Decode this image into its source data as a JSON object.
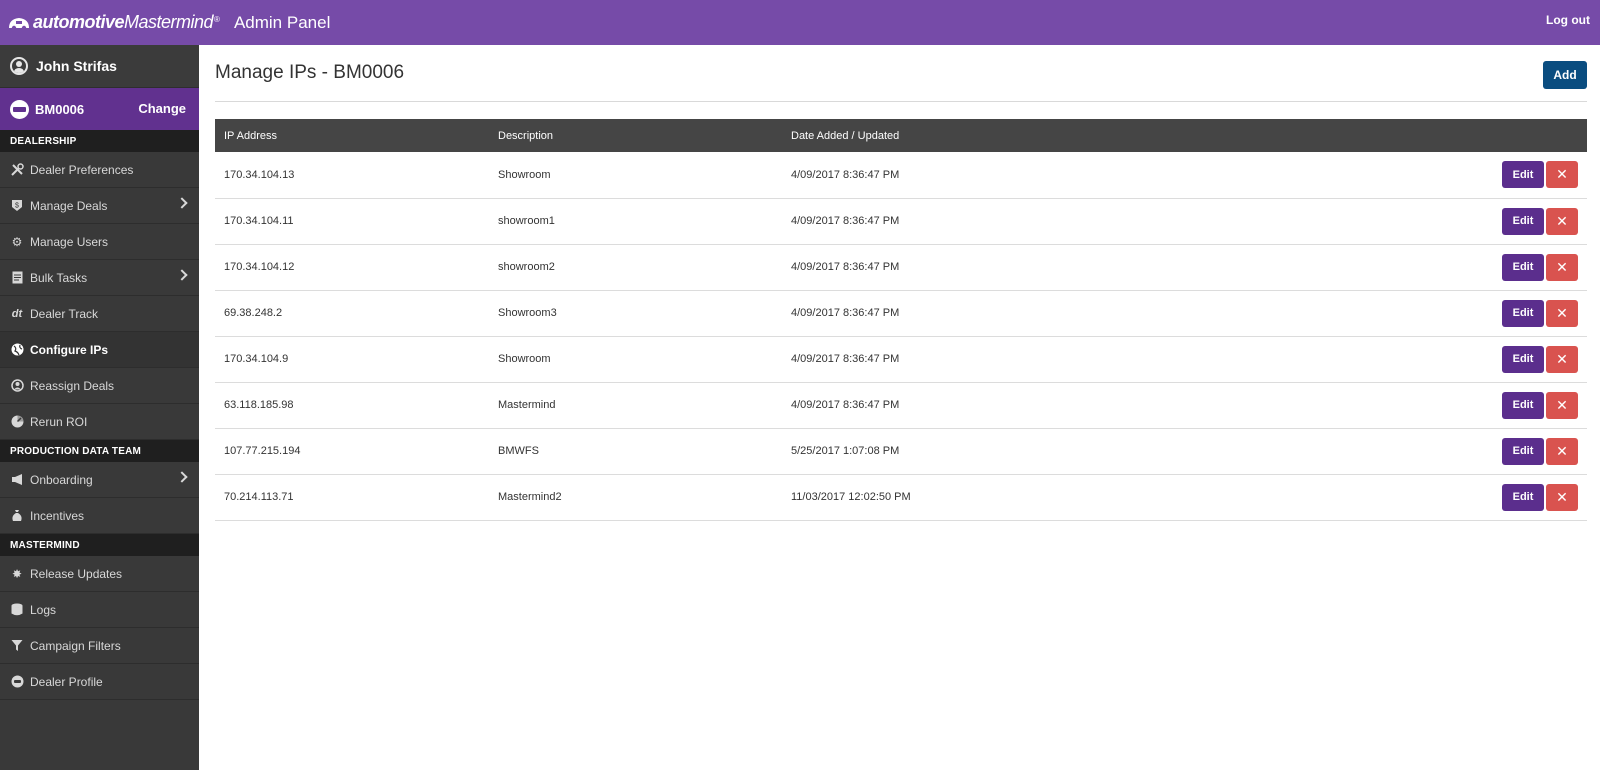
{
  "header": {
    "logo_text_bold": "automotive",
    "logo_text_regular": "Mastermind",
    "logo_reg": "®",
    "app_title": "Admin Panel",
    "logout_label": "Log out"
  },
  "sidebar": {
    "user_name": "John Strifas",
    "dealer_code": "BM0006",
    "change_label": "Change",
    "sections": [
      {
        "title": "DEALERSHIP",
        "items": [
          {
            "label": "Dealer Preferences",
            "icon": "tools-icon"
          },
          {
            "label": "Manage Deals",
            "icon": "dollar-shield-icon",
            "has_submenu": true
          },
          {
            "label": "Manage Users",
            "icon": "gear-icon"
          },
          {
            "label": "Bulk Tasks",
            "icon": "document-icon",
            "has_submenu": true
          },
          {
            "label": "Dealer Track",
            "icon": "dealertrack-icon"
          },
          {
            "label": "Configure IPs",
            "icon": "globe-icon",
            "active": true
          },
          {
            "label": "Reassign Deals",
            "icon": "user-circle-icon"
          },
          {
            "label": "Rerun ROI",
            "icon": "gauge-icon"
          }
        ]
      },
      {
        "title": "PRODUCTION DATA TEAM",
        "items": [
          {
            "label": "Onboarding",
            "icon": "megaphone-icon",
            "has_submenu": true
          },
          {
            "label": "Incentives",
            "icon": "money-bag-icon"
          }
        ]
      },
      {
        "title": "MASTERMIND",
        "items": [
          {
            "label": "Release Updates",
            "icon": "badge-gear-icon"
          },
          {
            "label": "Logs",
            "icon": "database-icon"
          },
          {
            "label": "Campaign Filters",
            "icon": "filter-icon"
          },
          {
            "label": "Dealer Profile",
            "icon": "car-icon"
          }
        ]
      }
    ]
  },
  "main": {
    "title": "Manage IPs - BM0006",
    "add_label": "Add",
    "table": {
      "headers": [
        "IP Address",
        "Description",
        "Date Added / Updated"
      ],
      "edit_label": "Edit",
      "delete_glyph": "✕",
      "rows": [
        {
          "ip": "170.34.104.13",
          "description": "Showroom",
          "date": "4/09/2017 8:36:47 PM"
        },
        {
          "ip": "170.34.104.11",
          "description": "showroom1",
          "date": "4/09/2017 8:36:47 PM"
        },
        {
          "ip": "170.34.104.12",
          "description": "showroom2",
          "date": "4/09/2017 8:36:47 PM"
        },
        {
          "ip": "69.38.248.2",
          "description": "Showroom3",
          "date": "4/09/2017 8:36:47 PM"
        },
        {
          "ip": "170.34.104.9",
          "description": "Showroom",
          "date": "4/09/2017 8:36:47 PM"
        },
        {
          "ip": "63.118.185.98",
          "description": "Mastermind",
          "date": "4/09/2017 8:36:47 PM"
        },
        {
          "ip": "107.77.215.194",
          "description": "BMWFS",
          "date": "5/25/2017 1:07:08 PM"
        },
        {
          "ip": "70.214.113.71",
          "description": "Mastermind2",
          "date": "11/03/2017 12:02:50 PM"
        }
      ]
    }
  },
  "colors": {
    "topbar": "#764ba8",
    "dealer_row": "#61318f",
    "sidebar": "#393939",
    "table_header": "#454545",
    "add_button": "#0a4d80",
    "edit_button": "#5b2e8d",
    "delete_button": "#d9534f"
  }
}
